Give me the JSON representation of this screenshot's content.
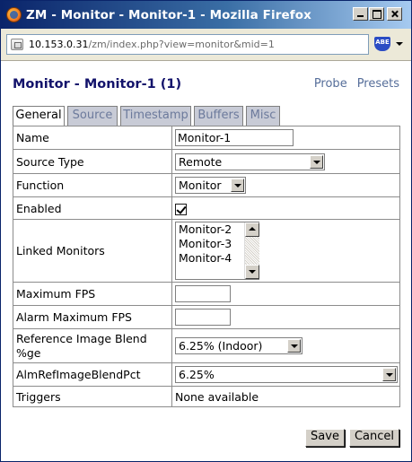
{
  "window": {
    "title": "ZM - Monitor - Monitor-1 - Mozilla Firefox"
  },
  "address_bar": {
    "url_host": "10.153.0.31",
    "url_path": "/zm/index.php?view=monitor&mid=1",
    "addon_label": "ABE"
  },
  "header": {
    "title": "Monitor - Monitor-1 (1)",
    "links": [
      "Probe",
      "Presets"
    ]
  },
  "tabs": [
    {
      "label": "General",
      "active": true
    },
    {
      "label": "Source",
      "active": false
    },
    {
      "label": "Timestamp",
      "active": false
    },
    {
      "label": "Buffers",
      "active": false
    },
    {
      "label": "Misc",
      "active": false
    }
  ],
  "form": {
    "name": {
      "label": "Name",
      "value": "Monitor-1"
    },
    "source_type": {
      "label": "Source Type",
      "value": "Remote"
    },
    "function": {
      "label": "Function",
      "value": "Monitor"
    },
    "enabled": {
      "label": "Enabled",
      "checked": true
    },
    "linked_monitors": {
      "label": "Linked Monitors",
      "options": [
        "Monitor-2",
        "Monitor-3",
        "Monitor-4"
      ]
    },
    "max_fps": {
      "label": "Maximum FPS",
      "value": ""
    },
    "alarm_max_fps": {
      "label": "Alarm Maximum FPS",
      "value": ""
    },
    "ref_blend": {
      "label": "Reference Image Blend %ge",
      "value": "6.25% (Indoor)"
    },
    "alm_ref_blend": {
      "label": "AlmRefImageBlendPct",
      "value": "6.25%"
    },
    "triggers": {
      "label": "Triggers",
      "value": "None available"
    }
  },
  "actions": {
    "save": "Save",
    "cancel": "Cancel"
  }
}
